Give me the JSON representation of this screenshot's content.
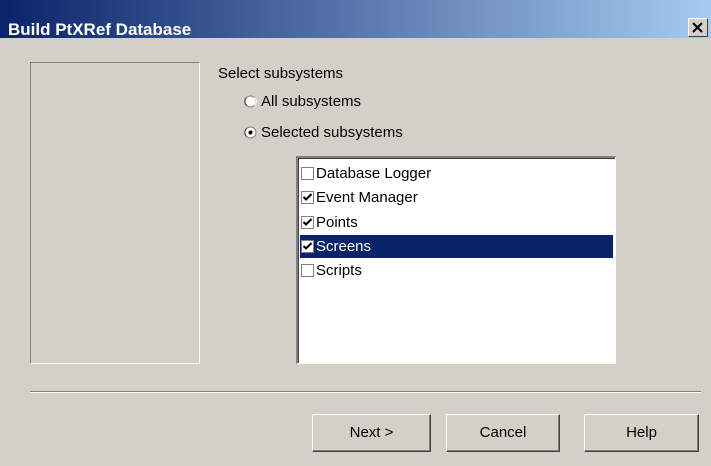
{
  "window": {
    "title": "Build PtXRef Database",
    "close_icon": "close-icon"
  },
  "subsystems": {
    "group_label": "Select subsystems",
    "options": [
      {
        "label": "All subsystems",
        "selected": false
      },
      {
        "label": "Selected subsystems",
        "selected": true
      }
    ],
    "items": [
      {
        "label": "Database Logger",
        "checked": false,
        "highlighted": false
      },
      {
        "label": "Event Manager",
        "checked": true,
        "highlighted": false
      },
      {
        "label": "Points",
        "checked": true,
        "highlighted": false
      },
      {
        "label": "Screens",
        "checked": true,
        "highlighted": true
      },
      {
        "label": "Scripts",
        "checked": false,
        "highlighted": false
      }
    ]
  },
  "buttons": {
    "next": "Next >",
    "cancel": "Cancel",
    "help": "Help"
  },
  "colors": {
    "titlebar": "#0a246a",
    "face": "#d4d0c8",
    "selection": "#0a246a"
  }
}
